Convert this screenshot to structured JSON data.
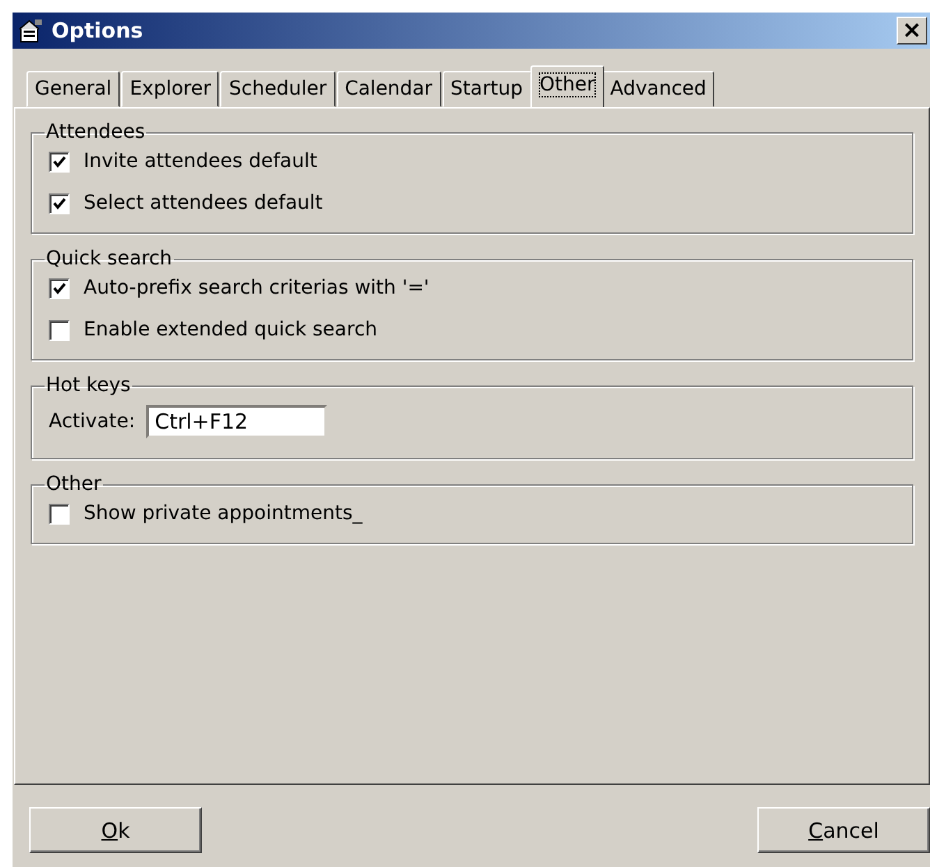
{
  "window": {
    "title": "Options",
    "close": "×"
  },
  "tabs": [
    {
      "label": "General",
      "selected": false
    },
    {
      "label": "Explorer",
      "selected": false
    },
    {
      "label": "Scheduler",
      "selected": false
    },
    {
      "label": "Calendar",
      "selected": false
    },
    {
      "label": "Startup",
      "selected": false
    },
    {
      "label": "Other",
      "selected": true
    },
    {
      "label": "Advanced",
      "selected": false
    }
  ],
  "groups": [
    {
      "title": "Attendees",
      "items": [
        {
          "kind": "checkbox",
          "label": "Invite attendees default",
          "checked": true
        },
        {
          "kind": "checkbox",
          "label": "Select attendees default",
          "checked": true
        }
      ]
    },
    {
      "title": "Quick search",
      "items": [
        {
          "kind": "checkbox",
          "label": "Auto-prefix search criterias with '='",
          "checked": true
        },
        {
          "kind": "checkbox",
          "label": "Enable extended quick search",
          "checked": false
        }
      ]
    },
    {
      "title": "Hot keys",
      "items": [
        {
          "kind": "field",
          "label": "Activate:",
          "value": "Ctrl+F12"
        }
      ]
    },
    {
      "title": "Other",
      "items": [
        {
          "kind": "checkbox",
          "label": "Show private appointments_",
          "checked": false
        }
      ]
    }
  ],
  "buttons": [
    {
      "label": "Ok",
      "first_letter_underlined": true
    },
    {
      "label": "Cancel",
      "first_letter_underlined": true
    }
  ]
}
